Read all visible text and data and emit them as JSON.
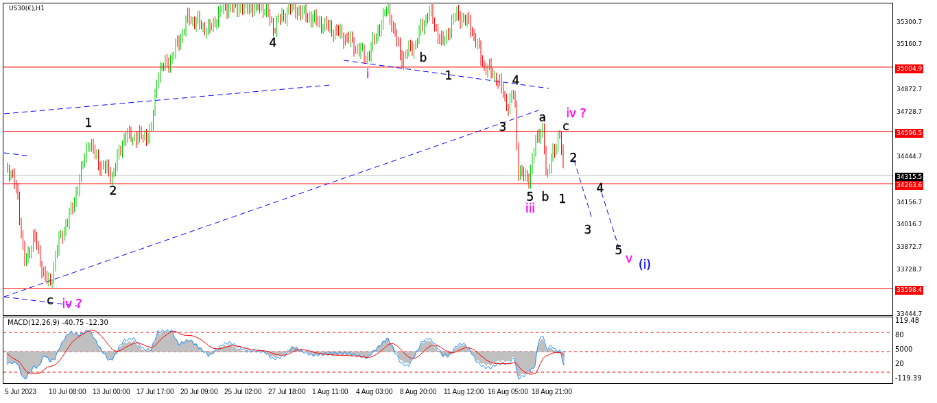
{
  "chart": {
    "title": "US30(€),H1"
  },
  "price_axis": [
    {
      "label": "35300.7",
      "kind": "tick"
    },
    {
      "label": "35160.7",
      "kind": "tick"
    },
    {
      "label": "35004.9",
      "kind": "level"
    },
    {
      "label": "34872.7",
      "kind": "tick"
    },
    {
      "label": "34728.7",
      "kind": "tick"
    },
    {
      "label": "34596.5",
      "kind": "level"
    },
    {
      "label": "34444.7",
      "kind": "tick"
    },
    {
      "label": "34315.5",
      "kind": "current"
    },
    {
      "label": "34263.6",
      "kind": "level"
    },
    {
      "label": "34156.7",
      "kind": "tick"
    },
    {
      "label": "34016.7",
      "kind": "tick"
    },
    {
      "label": "33872.7",
      "kind": "tick"
    },
    {
      "label": "33728.7",
      "kind": "tick"
    },
    {
      "label": "33598.4",
      "kind": "level"
    },
    {
      "label": "33444.7",
      "kind": "tick"
    }
  ],
  "wave_labels": [
    {
      "text": "4",
      "color": "#000000"
    },
    {
      "text": "i",
      "color": "#ff00ff"
    },
    {
      "text": "b",
      "color": "#000000"
    },
    {
      "text": "1",
      "color": "#000000"
    },
    {
      "text": "4",
      "color": "#000000"
    },
    {
      "text": "1",
      "color": "#000000"
    },
    {
      "text": "2",
      "color": "#000000"
    },
    {
      "text": "3",
      "color": "#000000"
    },
    {
      "text": "a",
      "color": "#000000"
    },
    {
      "text": "iv ?",
      "color": "#ff00ff"
    },
    {
      "text": "c",
      "color": "#000000"
    },
    {
      "text": "2",
      "color": "#000000"
    },
    {
      "text": "5",
      "color": "#000000"
    },
    {
      "text": "b",
      "color": "#000000"
    },
    {
      "text": "1",
      "color": "#000000"
    },
    {
      "text": "4",
      "color": "#000000"
    },
    {
      "text": "iii",
      "color": "#ff00ff"
    },
    {
      "text": "3",
      "color": "#000000"
    },
    {
      "text": "5",
      "color": "#000000"
    },
    {
      "text": "v",
      "color": "#ff00ff"
    },
    {
      "text": "(i)",
      "color": "#0000ff"
    },
    {
      "text": "c",
      "color": "#000000"
    },
    {
      "text": "iv ?",
      "color": "#ff00ff"
    }
  ],
  "macd": {
    "title": "MACD(12,26,9) -40.75 -12.30",
    "axis": [
      "119.48",
      "80",
      "5000",
      "20",
      "-119.39"
    ]
  },
  "time_axis": [
    "5 Jul 2023",
    "10 Jul 08:00",
    "13 Jul 00:00",
    "17 Jul 17:00",
    "20 Jul 09:00",
    "25 Jul 02:00",
    "27 Jul 18:00",
    "1 Aug 11:00",
    "4 Aug 03:00",
    "8 Aug 20:00",
    "11 Aug 12:00",
    "16 Aug 05:00",
    "18 Aug 21:00"
  ]
}
